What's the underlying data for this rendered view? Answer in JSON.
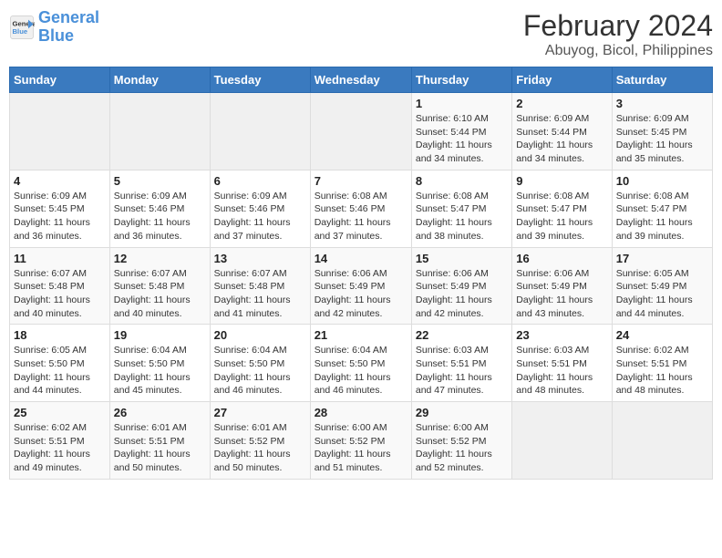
{
  "header": {
    "logo_line1": "General",
    "logo_line2": "Blue",
    "title": "February 2024",
    "subtitle": "Abuyog, Bicol, Philippines"
  },
  "days_of_week": [
    "Sunday",
    "Monday",
    "Tuesday",
    "Wednesday",
    "Thursday",
    "Friday",
    "Saturday"
  ],
  "weeks": [
    [
      {
        "day": "",
        "empty": true
      },
      {
        "day": "",
        "empty": true
      },
      {
        "day": "",
        "empty": true
      },
      {
        "day": "",
        "empty": true
      },
      {
        "day": "1",
        "sunrise": "6:10 AM",
        "sunset": "5:44 PM",
        "daylight": "11 hours and 34 minutes."
      },
      {
        "day": "2",
        "sunrise": "6:09 AM",
        "sunset": "5:44 PM",
        "daylight": "11 hours and 34 minutes."
      },
      {
        "day": "3",
        "sunrise": "6:09 AM",
        "sunset": "5:45 PM",
        "daylight": "11 hours and 35 minutes."
      }
    ],
    [
      {
        "day": "4",
        "sunrise": "6:09 AM",
        "sunset": "5:45 PM",
        "daylight": "11 hours and 36 minutes."
      },
      {
        "day": "5",
        "sunrise": "6:09 AM",
        "sunset": "5:46 PM",
        "daylight": "11 hours and 36 minutes."
      },
      {
        "day": "6",
        "sunrise": "6:09 AM",
        "sunset": "5:46 PM",
        "daylight": "11 hours and 37 minutes."
      },
      {
        "day": "7",
        "sunrise": "6:08 AM",
        "sunset": "5:46 PM",
        "daylight": "11 hours and 37 minutes."
      },
      {
        "day": "8",
        "sunrise": "6:08 AM",
        "sunset": "5:47 PM",
        "daylight": "11 hours and 38 minutes."
      },
      {
        "day": "9",
        "sunrise": "6:08 AM",
        "sunset": "5:47 PM",
        "daylight": "11 hours and 39 minutes."
      },
      {
        "day": "10",
        "sunrise": "6:08 AM",
        "sunset": "5:47 PM",
        "daylight": "11 hours and 39 minutes."
      }
    ],
    [
      {
        "day": "11",
        "sunrise": "6:07 AM",
        "sunset": "5:48 PM",
        "daylight": "11 hours and 40 minutes."
      },
      {
        "day": "12",
        "sunrise": "6:07 AM",
        "sunset": "5:48 PM",
        "daylight": "11 hours and 40 minutes."
      },
      {
        "day": "13",
        "sunrise": "6:07 AM",
        "sunset": "5:48 PM",
        "daylight": "11 hours and 41 minutes."
      },
      {
        "day": "14",
        "sunrise": "6:06 AM",
        "sunset": "5:49 PM",
        "daylight": "11 hours and 42 minutes."
      },
      {
        "day": "15",
        "sunrise": "6:06 AM",
        "sunset": "5:49 PM",
        "daylight": "11 hours and 42 minutes."
      },
      {
        "day": "16",
        "sunrise": "6:06 AM",
        "sunset": "5:49 PM",
        "daylight": "11 hours and 43 minutes."
      },
      {
        "day": "17",
        "sunrise": "6:05 AM",
        "sunset": "5:49 PM",
        "daylight": "11 hours and 44 minutes."
      }
    ],
    [
      {
        "day": "18",
        "sunrise": "6:05 AM",
        "sunset": "5:50 PM",
        "daylight": "11 hours and 44 minutes."
      },
      {
        "day": "19",
        "sunrise": "6:04 AM",
        "sunset": "5:50 PM",
        "daylight": "11 hours and 45 minutes."
      },
      {
        "day": "20",
        "sunrise": "6:04 AM",
        "sunset": "5:50 PM",
        "daylight": "11 hours and 46 minutes."
      },
      {
        "day": "21",
        "sunrise": "6:04 AM",
        "sunset": "5:50 PM",
        "daylight": "11 hours and 46 minutes."
      },
      {
        "day": "22",
        "sunrise": "6:03 AM",
        "sunset": "5:51 PM",
        "daylight": "11 hours and 47 minutes."
      },
      {
        "day": "23",
        "sunrise": "6:03 AM",
        "sunset": "5:51 PM",
        "daylight": "11 hours and 48 minutes."
      },
      {
        "day": "24",
        "sunrise": "6:02 AM",
        "sunset": "5:51 PM",
        "daylight": "11 hours and 48 minutes."
      }
    ],
    [
      {
        "day": "25",
        "sunrise": "6:02 AM",
        "sunset": "5:51 PM",
        "daylight": "11 hours and 49 minutes."
      },
      {
        "day": "26",
        "sunrise": "6:01 AM",
        "sunset": "5:51 PM",
        "daylight": "11 hours and 50 minutes."
      },
      {
        "day": "27",
        "sunrise": "6:01 AM",
        "sunset": "5:52 PM",
        "daylight": "11 hours and 50 minutes."
      },
      {
        "day": "28",
        "sunrise": "6:00 AM",
        "sunset": "5:52 PM",
        "daylight": "11 hours and 51 minutes."
      },
      {
        "day": "29",
        "sunrise": "6:00 AM",
        "sunset": "5:52 PM",
        "daylight": "11 hours and 52 minutes."
      },
      {
        "day": "",
        "empty": true
      },
      {
        "day": "",
        "empty": true
      }
    ]
  ],
  "labels": {
    "sunrise": "Sunrise:",
    "sunset": "Sunset:",
    "daylight": "Daylight:"
  }
}
